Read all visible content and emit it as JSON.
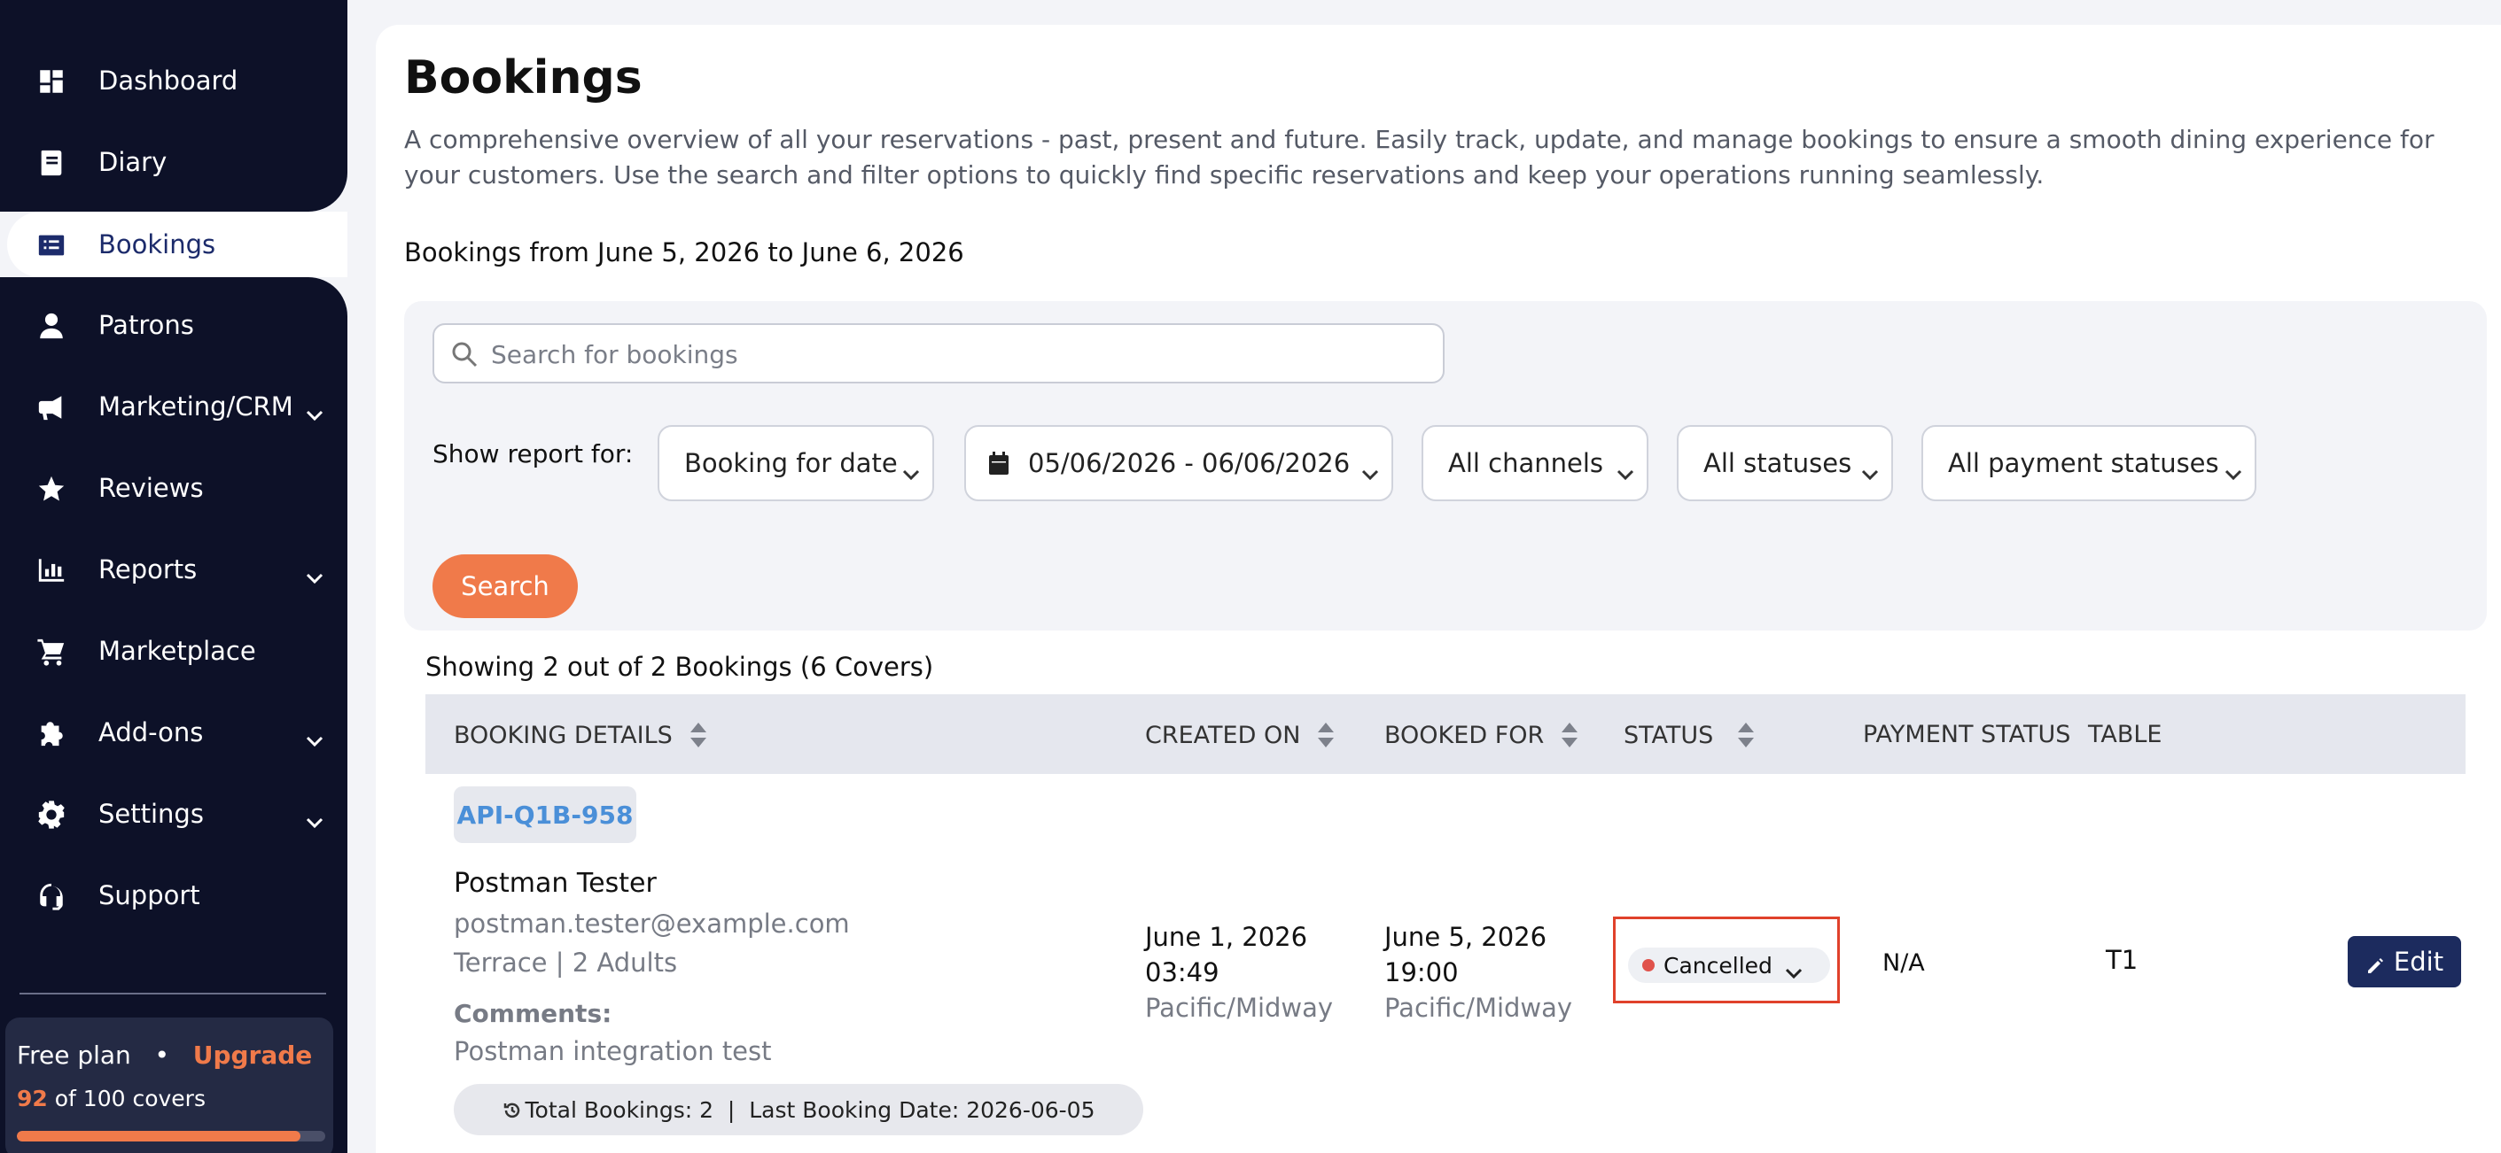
{
  "sidebar": {
    "items": [
      {
        "label": "Dashboard",
        "icon": "dashboard-icon"
      },
      {
        "label": "Diary",
        "icon": "book-icon"
      },
      {
        "label": "Bookings",
        "icon": "list-icon",
        "active": true
      },
      {
        "label": "Patrons",
        "icon": "user-icon"
      },
      {
        "label": "Marketing/CRM",
        "icon": "megaphone-icon",
        "expandable": true
      },
      {
        "label": "Reviews",
        "icon": "star-icon"
      },
      {
        "label": "Reports",
        "icon": "bar-chart-icon",
        "expandable": true
      },
      {
        "label": "Marketplace",
        "icon": "cart-icon"
      },
      {
        "label": "Add-ons",
        "icon": "puzzle-icon",
        "expandable": true
      },
      {
        "label": "Settings",
        "icon": "gear-icon",
        "expandable": true
      },
      {
        "label": "Support",
        "icon": "headset-icon"
      }
    ],
    "plan": {
      "name": "Free plan",
      "separator": "•",
      "upgrade_label": "Upgrade",
      "covers_used": "92",
      "covers_text": "of 100 covers",
      "usage_fraction": 0.92
    }
  },
  "page": {
    "title": "Bookings",
    "description": "A comprehensive overview of all your reservations - past, present and future. Easily track, update, and manage bookings to ensure a smooth dining experience for your customers. Use the search and filter options to quickly find specific reservations and keep your operations running seamlessly.",
    "range_label": "Bookings from June 5, 2026 to June 6, 2026"
  },
  "filters": {
    "search_placeholder": "Search for bookings",
    "show_report_label": "Show report for:",
    "booking_for": "Booking for date",
    "date_range": "05/06/2026 - 06/06/2026",
    "channels": "All channels",
    "statuses": "All statuses",
    "payment_statuses": "All payment statuses",
    "search_button": "Search"
  },
  "results": {
    "summary": "Showing 2 out of 2 Bookings (6 Covers)",
    "columns": [
      "BOOKING DETAILS",
      "CREATED ON",
      "BOOKED FOR",
      "STATUS",
      "PAYMENT STATUS",
      "TABLE"
    ],
    "rows": [
      {
        "booking_id": "API-Q1B-958",
        "name": "Postman Tester",
        "email": "postman.tester@example.com",
        "meta": "Terrace | 2 Adults",
        "comments_label": "Comments:",
        "comments": "Postman integration test",
        "history": "Total Bookings: 2  |  Last Booking Date: 2026-06-05",
        "created_date": "June 1, 2026",
        "created_time": "03:49",
        "created_tz": "Pacific/Midway",
        "booked_date": "June 5, 2026",
        "booked_time": "19:00",
        "booked_tz": "Pacific/Midway",
        "status": "Cancelled",
        "status_color": "#e0524b",
        "payment_status": "N/A",
        "table": "T1",
        "edit_label": "Edit"
      }
    ]
  },
  "colors": {
    "sidebar_bg": "#0d1128",
    "accent": "#f07a4a",
    "primary": "#1c2b5e",
    "highlight_border": "#e0412b"
  }
}
